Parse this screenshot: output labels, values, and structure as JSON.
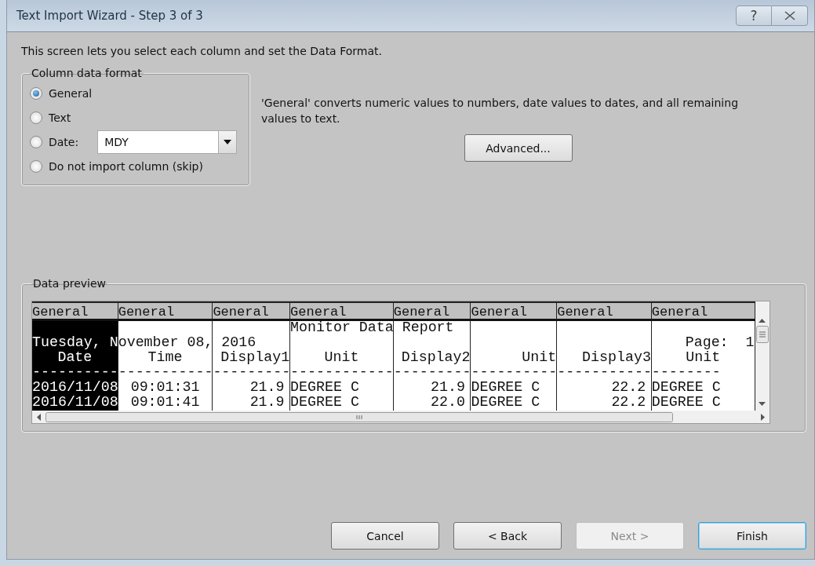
{
  "window": {
    "title": "Text Import Wizard - Step 3 of 3",
    "help_glyph": "?"
  },
  "intro": "This screen lets you select each column and set the Data Format.",
  "column_data_format": {
    "legend": "Column data format",
    "options": [
      {
        "kind": "plain",
        "label": "General",
        "selected": true
      },
      {
        "kind": "plain",
        "label": "Text",
        "selected": false
      },
      {
        "kind": "date",
        "label": "Date:",
        "selected": false,
        "value": "MDY"
      },
      {
        "kind": "plain",
        "label": "Do not import column (skip)",
        "selected": false
      }
    ]
  },
  "description": "'General' converts numeric values to numbers, date values to dates, and all remaining values to text.",
  "advanced_button": "Advanced...",
  "data_preview": {
    "legend": "Data preview",
    "columns": [
      {
        "header": "General",
        "selected": true
      },
      {
        "header": "General",
        "selected": false
      },
      {
        "header": "General",
        "selected": false
      },
      {
        "header": "General",
        "selected": false
      },
      {
        "header": "General",
        "selected": false
      },
      {
        "header": "General",
        "selected": false
      },
      {
        "header": "General",
        "selected": false
      },
      {
        "header": "General",
        "selected": false
      }
    ],
    "rows": [
      {
        "kind": "text",
        "cells": [
          null,
          null,
          null,
          "Monitor Data",
          " Report",
          null,
          null,
          null
        ]
      },
      {
        "kind": "text",
        "cells": [
          "Tuesday, N",
          "ovember 08,",
          " 2016",
          null,
          null,
          null,
          null,
          "Page:  1"
        ]
      },
      {
        "kind": "heading",
        "cells": [
          "Date",
          "Time",
          "Display1",
          "Unit",
          "Display2",
          "Unit",
          "Display3",
          "Unit"
        ]
      },
      {
        "kind": "rule",
        "cells": [
          "----------",
          "-----------",
          "---------",
          "------------",
          "---------",
          "----------",
          "-----------",
          "--------"
        ]
      },
      {
        "kind": "data",
        "cells": [
          "2016/11/08",
          "09:01:31",
          "21.9",
          "DEGREE C",
          "21.9",
          "DEGREE C",
          "22.2",
          "DEGREE C"
        ]
      },
      {
        "kind": "data",
        "cells": [
          "2016/11/08",
          "09:01:41",
          "21.9",
          "DEGREE C",
          "22.0",
          "DEGREE C",
          "22.2",
          "DEGREE C"
        ]
      }
    ]
  },
  "buttons": [
    {
      "label": "Cancel",
      "disabled": false,
      "default": false
    },
    {
      "label": "< Back",
      "disabled": false,
      "default": false
    },
    {
      "label": "Next >",
      "disabled": true,
      "default": false
    },
    {
      "label": "Finish",
      "disabled": false,
      "default": true
    }
  ]
}
